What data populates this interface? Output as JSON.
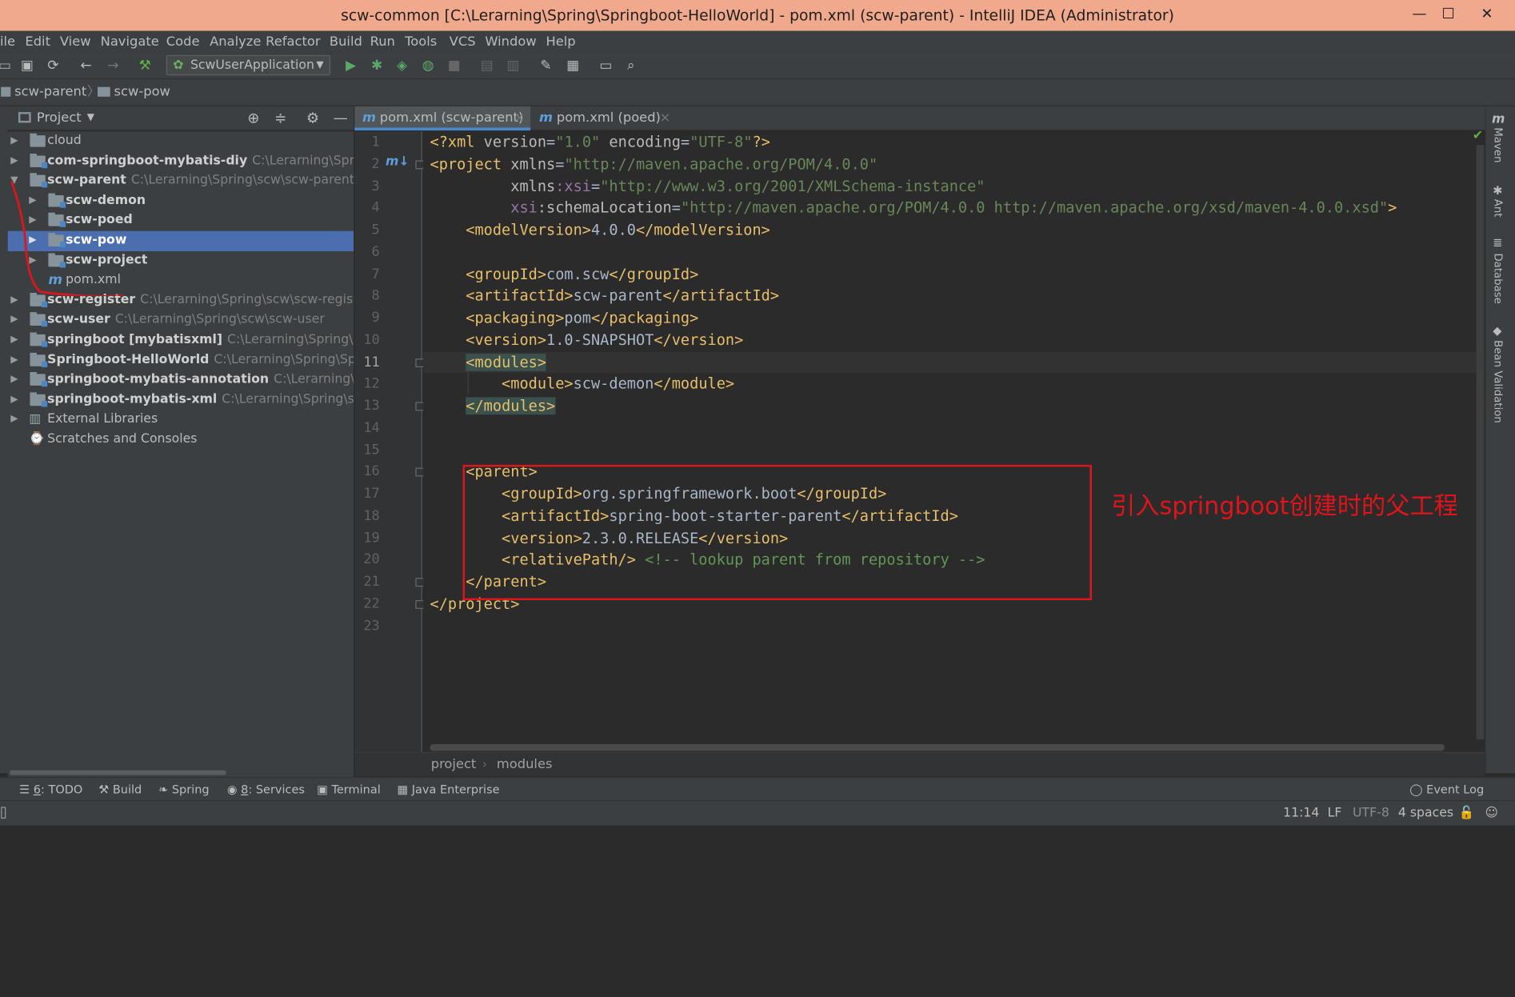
{
  "window": {
    "title": "scw-common [C:\\Lerarning\\Spring\\Springboot-HelloWorld] - pom.xml (scw-parent) - IntelliJ IDEA (Administrator)",
    "minimize": "—",
    "maximize": "☐",
    "close": "✕"
  },
  "menu": [
    "ile",
    "Edit",
    "View",
    "Navigate",
    "Code",
    "Analyze",
    "Refactor",
    "Build",
    "Run",
    "Tools",
    "VCS",
    "Window",
    "Help"
  ],
  "toolbar": {
    "run_config": "ScwUserApplication"
  },
  "breadcrumb": [
    "scw-parent",
    "scw-pow"
  ],
  "project_panel": {
    "title": "Project"
  },
  "tree": [
    {
      "name": "cloud",
      "path": ""
    },
    {
      "name": "com-springboot-mybatis-diy",
      "path": "C:\\Lerarning\\Spring\\c"
    },
    {
      "name": "scw-parent",
      "path": "C:\\Lerarning\\Spring\\scw\\scw-parent"
    },
    {
      "name": "scw-demon",
      "path": ""
    },
    {
      "name": "scw-poed",
      "path": ""
    },
    {
      "name": "scw-pow",
      "path": ""
    },
    {
      "name": "scw-project",
      "path": ""
    },
    {
      "name": "pom.xml",
      "path": ""
    },
    {
      "name": "scw-register",
      "path": "C:\\Lerarning\\Spring\\scw\\scw-register"
    },
    {
      "name": "scw-user",
      "path": "C:\\Lerarning\\Spring\\scw\\scw-user"
    },
    {
      "name": "springboot [mybatisxml]",
      "path": "C:\\Lerarning\\Spring\\sprinc"
    },
    {
      "name": "Springboot-HelloWorld",
      "path": "C:\\Lerarning\\Spring\\Spring"
    },
    {
      "name": "springboot-mybatis-annotation",
      "path": "C:\\Lerarning\\Sprin"
    },
    {
      "name": "springboot-mybatis-xml",
      "path": "C:\\Lerarning\\Spring\\spring"
    },
    {
      "name": "External Libraries",
      "path": ""
    },
    {
      "name": "Scratches and Consoles",
      "path": ""
    }
  ],
  "tabs": [
    {
      "icon": "m",
      "label": "pom.xml (scw-parent)"
    },
    {
      "icon": "m",
      "label": "pom.xml (poed)"
    }
  ],
  "editor": {
    "lines": [
      "1",
      "2",
      "3",
      "4",
      "5",
      "6",
      "7",
      "8",
      "9",
      "10",
      "11",
      "12",
      "13",
      "14",
      "15",
      "16",
      "17",
      "18",
      "19",
      "20",
      "21",
      "22",
      "23"
    ],
    "c1": {
      "a": "<?xml ",
      "b": "version",
      "c": "=",
      "d": "\"1.0\"",
      "e": " encoding",
      "f": "=",
      "g": "\"UTF-8\"",
      "h": "?>"
    },
    "c2": {
      "a": "<project ",
      "b": "xmlns",
      "c": "=",
      "d": "\"http://maven.apache.org/POM/4.0.0\""
    },
    "c3": {
      "a": "         xmlns",
      "b": ":xsi",
      "c": "=",
      "d": "\"http://www.w3.org/2001/XMLSchema-instance\""
    },
    "c4": {
      "a": "         xsi",
      "b": ":schemaLocation",
      "c": "=",
      "d": "\"http://maven.apache.org/POM/4.0.0 http://maven.apache.org/xsd/maven-4.0.0.xsd\"",
      "e": ">"
    },
    "c5": {
      "a": "    <modelVersion>",
      "b": "4.0.0",
      "c": "</modelVersion>"
    },
    "c7": {
      "a": "    <groupId>",
      "b": "com.scw",
      "c": "</groupId>"
    },
    "c8": {
      "a": "    <artifactId>",
      "b": "scw-parent",
      "c": "</artifactId>"
    },
    "c9": {
      "a": "    <packaging>",
      "b": "pom",
      "c": "</packaging>"
    },
    "c10": {
      "a": "    <version>",
      "b": "1.0-SNAPSHOT",
      "c": "</version>"
    },
    "c11": {
      "a": "<modules>"
    },
    "c12": {
      "a": "        <module>",
      "b": "scw-demon",
      "c": "</module>"
    },
    "c13": {
      "a": "</modules>"
    },
    "c16": {
      "a": "    <parent>"
    },
    "c17": {
      "a": "        <groupId>",
      "b": "org.springframework.boot",
      "c": "</groupId>"
    },
    "c18": {
      "a": "        <artifactId>",
      "b": "spring-boot-starter-parent",
      "c": "</artifactId>"
    },
    "c19": {
      "a": "        <version>",
      "b": "2.3.0.RELEASE",
      "c": "</version>"
    },
    "c20": {
      "a": "        <relativePath/>",
      "b": " <!-- lookup parent from repository -->"
    },
    "c21": {
      "a": "    </parent>"
    },
    "c22": {
      "a": "</project>"
    }
  },
  "annotation": "引入springboot创建时的父工程",
  "right_tools": [
    "Maven",
    "Ant",
    "Database",
    "Bean Validation"
  ],
  "code_breadcrumb": [
    "project",
    "modules"
  ],
  "tool_windows": [
    {
      "key": "6",
      "label": ": TODO"
    },
    {
      "label": "Build"
    },
    {
      "label": "Spring"
    },
    {
      "key": "8",
      "label": ": Services"
    },
    {
      "label": "Terminal"
    },
    {
      "label": "Java Enterprise"
    }
  ],
  "event_log": "Event Log",
  "status": {
    "position": "11:14",
    "line_sep": "LF",
    "encoding": "UTF-8",
    "indent": "4 spaces"
  }
}
